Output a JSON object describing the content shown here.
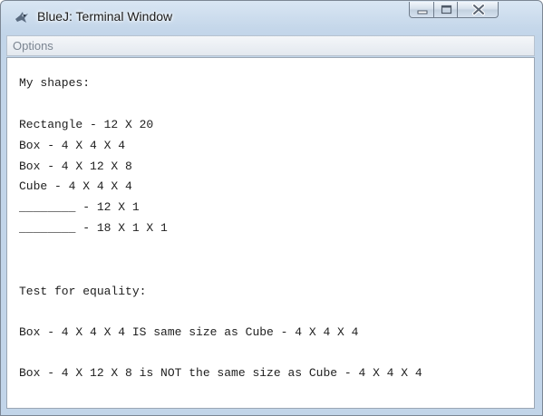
{
  "window": {
    "title": "BlueJ: Terminal Window"
  },
  "menubar": {
    "options_label": "Options"
  },
  "terminal": {
    "lines": [
      "My shapes:",
      "Rectangle - 12 X 20",
      "Box - 4 X 4 X 4",
      "Box - 4 X 12 X 8",
      "Cube - 4 X 4 X 4",
      "________ - 12 X 1",
      "________ - 18 X 1 X 1",
      "Test for equality:",
      "Box - 4 X 4 X 4 IS same size as Cube - 4 X 4 X 4",
      "Box - 4 X 12 X 8 is NOT the same size as Cube - 4 X 4 X 4"
    ]
  },
  "icons": {
    "app": "bluej-bird-icon",
    "minimize": "minimize-icon",
    "maximize": "maximize-icon",
    "close": "close-icon"
  },
  "colors": {
    "titlebar": "#c5d7ea",
    "close_glyph": "#5b6573"
  }
}
